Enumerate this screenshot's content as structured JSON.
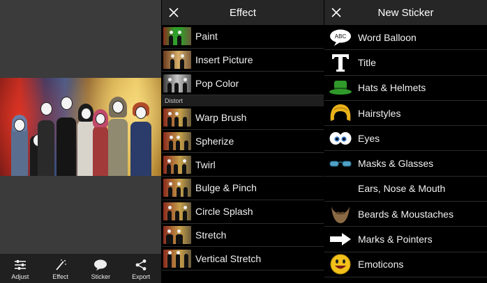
{
  "editor": {
    "toolbar": [
      {
        "label": "Adjust",
        "icon": "sliders-icon"
      },
      {
        "label": "Effect",
        "icon": "magic-wand-icon"
      },
      {
        "label": "Sticker",
        "icon": "speech-bubble-icon"
      },
      {
        "label": "Export",
        "icon": "share-icon"
      }
    ]
  },
  "effect_panel": {
    "title": "Effect",
    "items_top": [
      "Paint",
      "Insert Picture",
      "Pop Color"
    ],
    "section_label": "Distort",
    "items_distort": [
      "Warp Brush",
      "Spherize",
      "Twirl",
      "Bulge & Pinch",
      "Circle Splash",
      "Stretch",
      "Vertical Stretch"
    ]
  },
  "sticker_panel": {
    "title": "New Sticker",
    "items": [
      {
        "label": "Word Balloon",
        "icon": "word-balloon-icon",
        "icon_text": "ABC"
      },
      {
        "label": "Title",
        "icon": "title-t-icon"
      },
      {
        "label": "Hats & Helmets",
        "icon": "green-hat-icon"
      },
      {
        "label": "Hairstyles",
        "icon": "hair-icon"
      },
      {
        "label": "Eyes",
        "icon": "cartoon-eyes-icon"
      },
      {
        "label": "Masks & Glasses",
        "icon": "glasses-icon"
      },
      {
        "label": "Ears, Nose & Mouth",
        "icon": ""
      },
      {
        "label": "Beards & Moustaches",
        "icon": "beard-icon"
      },
      {
        "label": "Marks & Pointers",
        "icon": "arrow-pointer-icon"
      },
      {
        "label": "Emoticons",
        "icon": "smiley-icon"
      }
    ]
  },
  "colors": {
    "toolbar_bg": "#202020",
    "header_bg": "#262626",
    "canvas_bg": "#3b3b3b",
    "hat_green": "#2f9a2a",
    "hair_yellow": "#e9b21b",
    "glasses_blue": "#4fa3c7",
    "emoticon_yellow": "#f2c21a"
  }
}
